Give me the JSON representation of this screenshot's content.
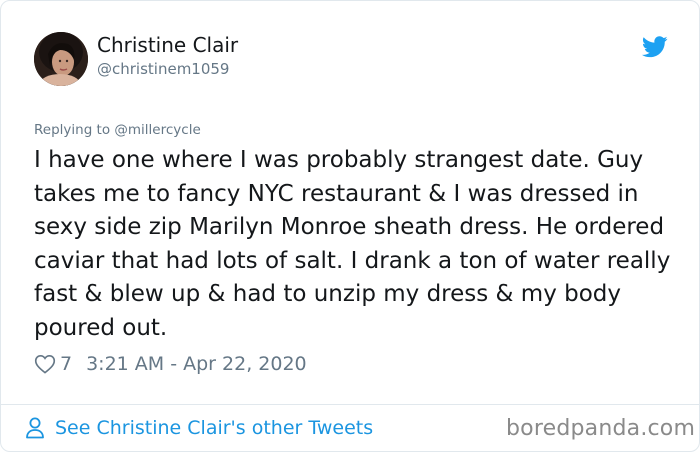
{
  "author": {
    "name": "Christine Clair",
    "handle": "@christinem1059"
  },
  "reply": {
    "prefix": "Replying to",
    "mention": "@millercycle"
  },
  "tweet": {
    "text": "I have one where I was probably strangest date. Guy takes me to fancy NYC restaurant & I was dressed in sexy side zip Marilyn Monroe sheath dress. He ordered caviar that had lots of salt. I drank a ton of water really fast & blew up & had to unzip my dress & my body poured out.",
    "likes": "7",
    "timestamp": "3:21 AM - Apr 22, 2020"
  },
  "footer": {
    "see_more_label": "See Christine Clair's other Tweets",
    "watermark": "boredpanda.com"
  },
  "icons": {
    "brand": "twitter-bird-icon",
    "like": "heart-icon",
    "profile": "person-icon"
  },
  "colors": {
    "link_blue": "#1b95e0",
    "twitter_blue": "#1da1f2",
    "secondary_text": "#657786",
    "border": "#e1e8ed"
  }
}
